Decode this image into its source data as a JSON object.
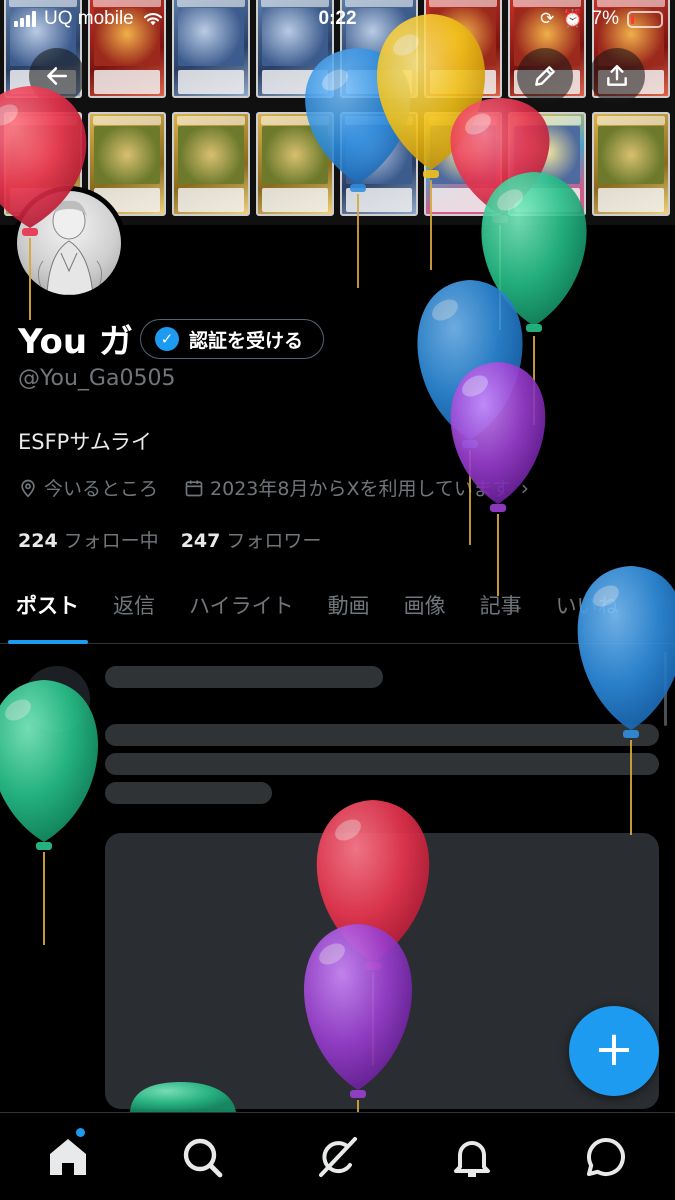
{
  "status_bar": {
    "carrier": "UQ mobile",
    "time": "0:22",
    "battery": "7%"
  },
  "header": {
    "back_icon": "arrow-left-icon",
    "edit_icon": "pencil-icon",
    "share_icon": "share-upload-icon"
  },
  "profile": {
    "display_name": "You ガ",
    "verify_label": "認証を受ける",
    "handle": "@You_Ga0505",
    "bio": "ESFPサムライ",
    "location": "今いるところ",
    "joined": "2023年8月からXを利用しています",
    "following_count": "224",
    "following_label": "フォロー中",
    "followers_count": "247",
    "followers_label": "フォロワー"
  },
  "tabs": [
    {
      "label": "ポスト",
      "active": true
    },
    {
      "label": "返信",
      "active": false
    },
    {
      "label": "ハイライト",
      "active": false
    },
    {
      "label": "動画",
      "active": false
    },
    {
      "label": "画像",
      "active": false
    },
    {
      "label": "記事",
      "active": false
    },
    {
      "label": "いいね",
      "active": false
    }
  ],
  "fab": {
    "label": "+",
    "icon": "plus-icon"
  },
  "bottom_nav": [
    {
      "name": "home",
      "icon": "home-icon"
    },
    {
      "name": "search",
      "icon": "search-icon"
    },
    {
      "name": "grok",
      "icon": "grok-icon"
    },
    {
      "name": "notifications",
      "icon": "bell-icon"
    },
    {
      "name": "messages",
      "icon": "message-icon"
    }
  ],
  "colors": {
    "accent": "#1d9bf0",
    "background": "#000000",
    "text_secondary": "#71767b",
    "balloon_red": "#e8354f",
    "balloon_blue": "#2f8fe0",
    "balloon_yellow": "#f2c21b",
    "balloon_green": "#27c08a",
    "balloon_purple": "#9b3fd1"
  }
}
